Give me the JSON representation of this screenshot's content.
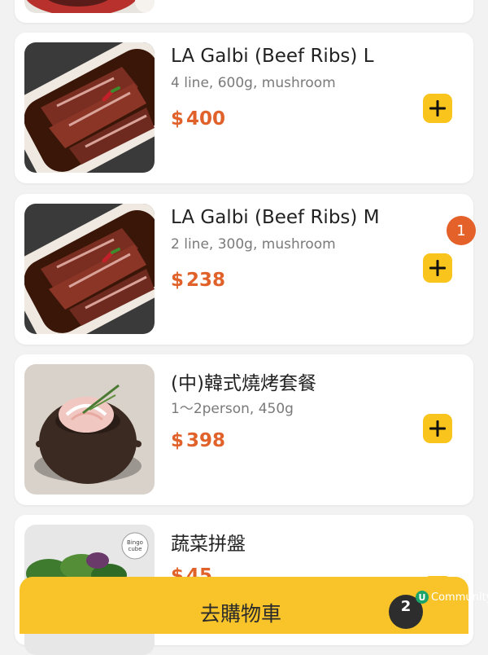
{
  "items": [
    {
      "name": "LA Galbi (Beef Ribs) L",
      "desc": "4 line, 600g, mushroom",
      "currency": "$",
      "price": "400",
      "image": "beef-ribs-photo"
    },
    {
      "name": "LA Galbi (Beef Ribs) M",
      "desc": "2 line, 300g, mushroom",
      "currency": "$",
      "price": "238",
      "image": "beef-ribs-photo"
    },
    {
      "name": "(中)韓式燒烤套餐",
      "desc": "1～2person, 450g",
      "currency": "$",
      "price": "398",
      "image": "meat-pot-photo"
    },
    {
      "name": "蔬菜拼盤",
      "desc": "",
      "currency": "$",
      "price": "45",
      "image": "vegetable-platter-photo",
      "photo_stamp": "Bingo cube"
    }
  ],
  "selected_badge": "1",
  "cart": {
    "label": "去購物車",
    "count": "2"
  },
  "watermark": {
    "logo": "U",
    "text": "Community"
  },
  "colors": {
    "accent": "#f9c41c",
    "price": "#e0622a",
    "badge": "#e5612a"
  },
  "icons": {
    "add": "plus-icon"
  }
}
